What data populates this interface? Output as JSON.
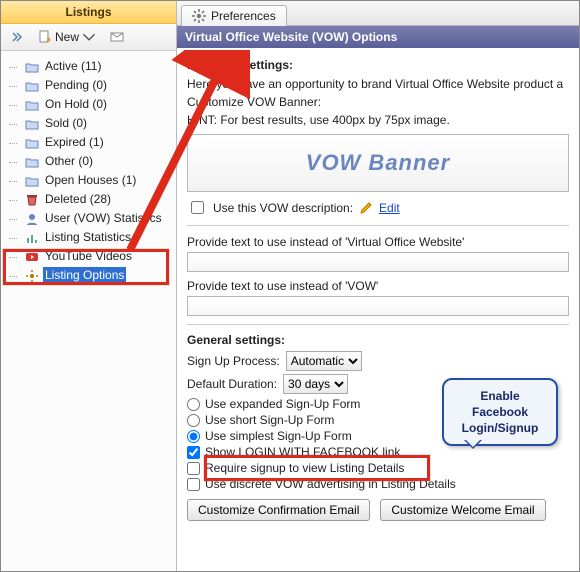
{
  "sidebar": {
    "title": "Listings",
    "new_button": "New",
    "items": [
      {
        "label": "Active (11)",
        "icon": "folder"
      },
      {
        "label": "Pending (0)",
        "icon": "folder"
      },
      {
        "label": "On Hold (0)",
        "icon": "folder"
      },
      {
        "label": "Sold (0)",
        "icon": "folder"
      },
      {
        "label": "Expired (1)",
        "icon": "folder"
      },
      {
        "label": "Other (0)",
        "icon": "folder"
      },
      {
        "label": "Open Houses (1)",
        "icon": "folder"
      },
      {
        "label": "Deleted (28)",
        "icon": "trash"
      },
      {
        "label": "User (VOW) Statistics",
        "icon": "user"
      },
      {
        "label": "Listing Statistics",
        "icon": "stats"
      },
      {
        "label": "YouTube Videos",
        "icon": "youtube"
      },
      {
        "label": "Listing Options",
        "icon": "gear",
        "selected": true
      }
    ]
  },
  "tab": {
    "label": "Preferences"
  },
  "panel": {
    "title": "Virtual Office Website (VOW) Options",
    "branding_header": "Branding settings:",
    "branding_intro": "Here you have an opportunity to brand Virtual Office Website product a",
    "customize_banner": "Customize VOW Banner:",
    "hint": "HINT: For best results, use 400px by 75px image.",
    "banner_placeholder": "VOW Banner",
    "use_desc_label": "Use this VOW description:",
    "edit_link": "Edit",
    "alt_full_label": "Provide text to use instead of 'Virtual Office Website'",
    "alt_short_label": "Provide text to use instead of 'VOW'",
    "general_header": "General settings:",
    "signup_label": "Sign Up Process:",
    "signup_value": "Automatic",
    "duration_label": "Default Duration:",
    "duration_value": "30 days",
    "radio_expanded": "Use expanded Sign-Up Form",
    "radio_short": "Use short Sign-Up Form",
    "radio_simple": "Use simplest Sign-Up Form",
    "chk_fb": "Show LOGIN WITH FACEBOOK link",
    "chk_require": "Require signup to view Listing Details",
    "chk_discrete": "Use discrete VOW advertising in Listing Details",
    "btn_confirm": "Customize Confirmation Email",
    "btn_welcome": "Customize Welcome Email"
  },
  "callout": {
    "l1": "Enable",
    "l2": "Facebook",
    "l3": "Login/Signup"
  }
}
